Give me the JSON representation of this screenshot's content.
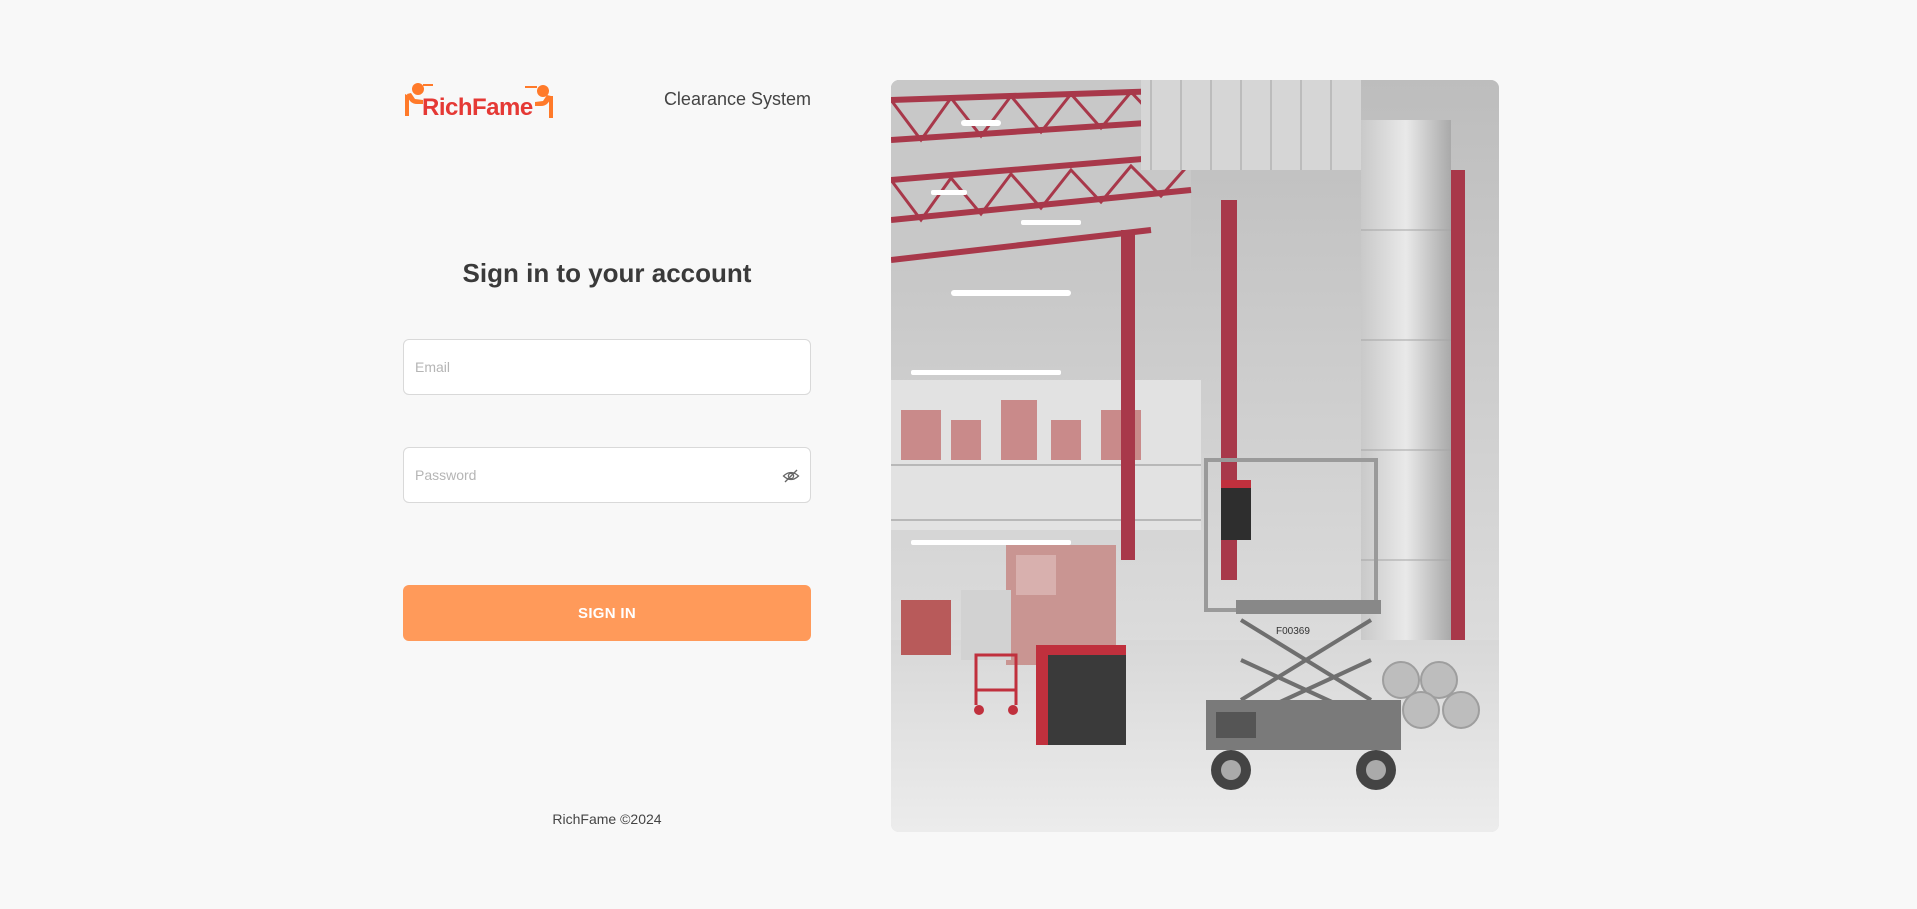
{
  "header": {
    "logo_text": "RichFame",
    "system_title": "Clearance System"
  },
  "form": {
    "heading": "Sign in to your account",
    "email_placeholder": "Email",
    "email_value": "",
    "password_placeholder": "Password",
    "password_value": "",
    "submit_label": "SIGN IN"
  },
  "footer": {
    "copyright": "RichFame ©2024"
  },
  "hero": {
    "machine_id": "F00369"
  },
  "colors": {
    "accent": "#ff9a5a",
    "logo_red": "#e53935",
    "logo_orange": "#ff7a2a",
    "background": "#f8f8f8",
    "steel_red": "#a8384a"
  },
  "icons": {
    "password_toggle": "eye-off-icon"
  }
}
